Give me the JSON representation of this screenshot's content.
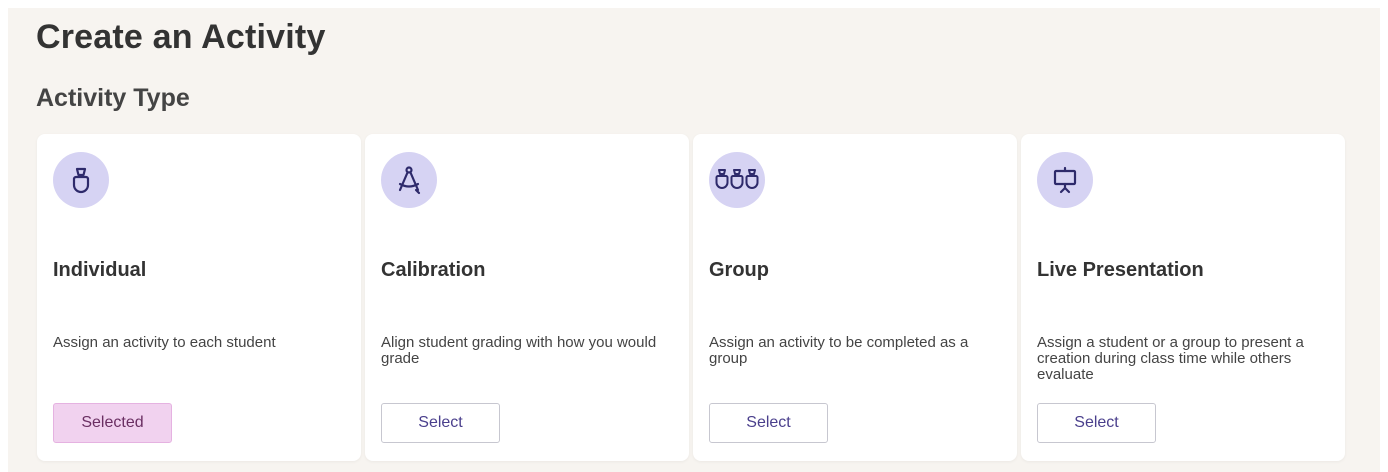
{
  "page": {
    "title": "Create an Activity",
    "section_title": "Activity Type"
  },
  "colors": {
    "panel_background": "#f7f4f0",
    "icon_circle": "#d6d3f3",
    "icon_stroke": "#2e2a6b",
    "selected_button_background": "#f1d2ef",
    "button_text": "#4a3f8c"
  },
  "activity_types": [
    {
      "icon": "person-icon",
      "title": "Individual",
      "description": "Assign an activity to each student",
      "button_label": "Selected",
      "selected": true
    },
    {
      "icon": "compass-icon",
      "title": "Calibration",
      "description": "Align student grading with how you would grade",
      "button_label": "Select",
      "selected": false
    },
    {
      "icon": "group-icon",
      "title": "Group",
      "description": "Assign an activity to be completed as a group",
      "button_label": "Select",
      "selected": false
    },
    {
      "icon": "presentation-board-icon",
      "title": "Live Presentation",
      "description": "Assign a student or a group to present a creation during class time while others evaluate",
      "button_label": "Select",
      "selected": false
    }
  ]
}
